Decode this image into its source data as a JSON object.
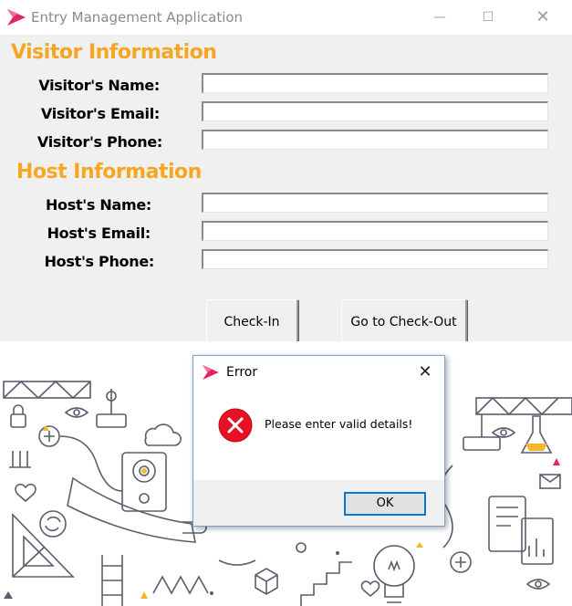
{
  "window": {
    "title": "Entry Management Application",
    "controls": {
      "minimize": "—",
      "maximize": "☐",
      "close": "✕"
    }
  },
  "visitor": {
    "heading": "Visitor Information",
    "name_label": "Visitor's Name:",
    "email_label": "Visitor's Email:",
    "phone_label": "Visitor's Phone:",
    "name_value": "",
    "email_value": "",
    "phone_value": ""
  },
  "host": {
    "heading": "Host Information",
    "name_label": "Host's Name:",
    "email_label": "Host's Email:",
    "phone_label": "Host's Phone:",
    "name_value": "",
    "email_value": "",
    "phone_value": ""
  },
  "actions": {
    "checkin_label": "Check-In",
    "checkout_label": "Go to Check-Out"
  },
  "dialog": {
    "title": "Error",
    "close": "✕",
    "message": "Please enter valid details!",
    "ok_label": "OK",
    "icon": "error-icon"
  },
  "colors": {
    "heading": "#f5a623",
    "error_red": "#e81123",
    "focus_blue": "#0078d7",
    "illustration_line": "#5c5c6e"
  }
}
